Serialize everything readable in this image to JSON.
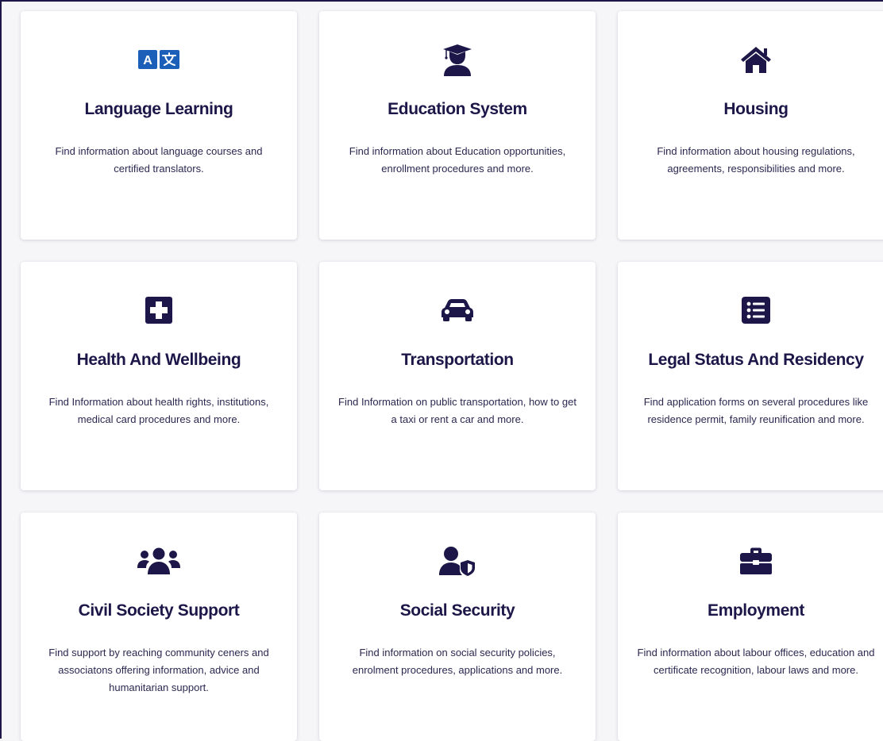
{
  "colors": {
    "accent": "#1c1748",
    "icon_blue": "#1c5fb8",
    "card_bg": "#ffffff",
    "page_bg": "#f6f6f8"
  },
  "cards": [
    {
      "icon": "language-translate-icon",
      "title": "Language Learning",
      "description": "Find information about language courses and certified translators."
    },
    {
      "icon": "graduate-icon",
      "title": "Education System",
      "description": "Find information about Education opportunities, enrollment procedures and more."
    },
    {
      "icon": "home-icon",
      "title": "Housing",
      "description": "Find information about housing regulations, agreements, responsibilities and more."
    },
    {
      "icon": "medical-plus-icon",
      "title": "Health And Wellbeing",
      "description": "Find Information about health rights, institutions, medical card procedures and more."
    },
    {
      "icon": "car-icon",
      "title": "Transportation",
      "description": "Find Information on public transportation, how to get a taxi or rent a car and more."
    },
    {
      "icon": "list-icon",
      "title": "Legal Status And Residency",
      "description": "Find application forms on several procedures like residence permit, family reunification and more."
    },
    {
      "icon": "users-icon",
      "title": "Civil Society Support",
      "description": "Find support by reaching community ceners and associatons offering information, advice and humanitarian support."
    },
    {
      "icon": "user-shield-icon",
      "title": "Social Security",
      "description": "Find information on social security policies, enrolment procedures, applications and more."
    },
    {
      "icon": "briefcase-icon",
      "title": "Employment",
      "description": "Find information about labour offices, education and certificate recognition, labour laws and more."
    }
  ]
}
